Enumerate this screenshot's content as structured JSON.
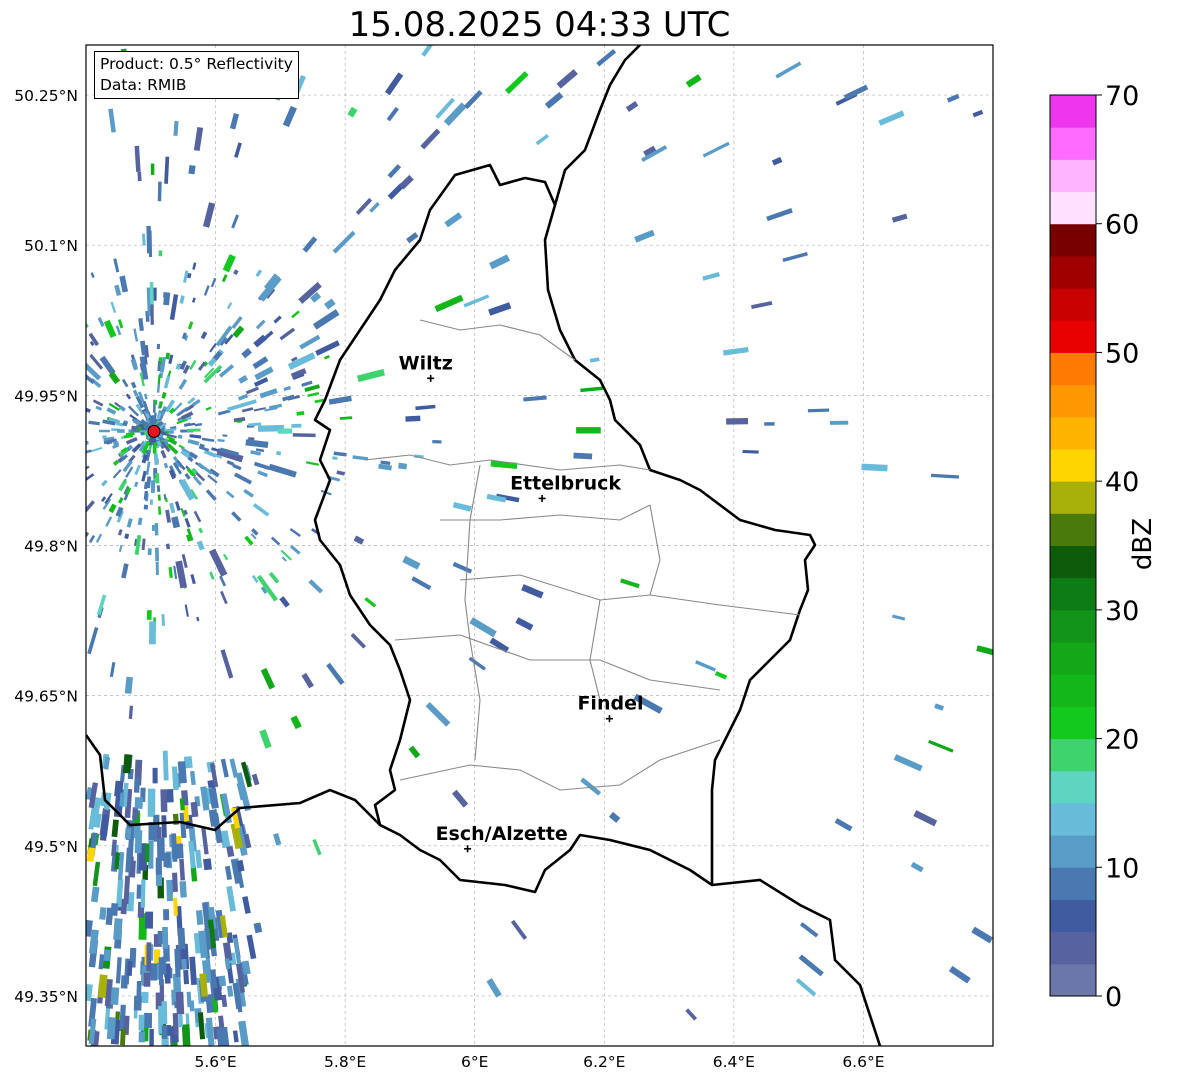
{
  "title": "15.08.2025 04:33 UTC",
  "info": {
    "product": "Product: 0.5° Reflectivity",
    "data": "Data: RMIB"
  },
  "map": {
    "lon_range": [
      5.4,
      6.8
    ],
    "lat_range": [
      49.3,
      50.3
    ],
    "lat_ticks": [
      {
        "value": 50.25,
        "label": "50.25°N"
      },
      {
        "value": 50.1,
        "label": "50.1°N"
      },
      {
        "value": 49.95,
        "label": "49.95°N"
      },
      {
        "value": 49.8,
        "label": "49.8°N"
      },
      {
        "value": 49.65,
        "label": "49.65°N"
      },
      {
        "value": 49.5,
        "label": "49.5°N"
      },
      {
        "value": 49.35,
        "label": "49.35°N"
      }
    ],
    "lon_ticks": [
      {
        "value": 5.6,
        "label": "5.6°E"
      },
      {
        "value": 5.8,
        "label": "5.8°E"
      },
      {
        "value": 6.0,
        "label": "6°E"
      },
      {
        "value": 6.2,
        "label": "6.2°E"
      },
      {
        "value": 6.4,
        "label": "6.4°E"
      },
      {
        "value": 6.6,
        "label": "6.6°E"
      }
    ],
    "grid": true,
    "radar_site": {
      "lon": 5.505,
      "lat": 49.914,
      "color": "#e8141e"
    },
    "cities": [
      {
        "name": "Wiltz",
        "lon": 5.932,
        "lat": 49.967
      },
      {
        "name": "Ettelbruck",
        "lon": 6.104,
        "lat": 49.847
      },
      {
        "name": "Findel",
        "lon": 6.208,
        "lat": 49.627
      },
      {
        "name": "Esch/Alzette",
        "lon": 5.989,
        "lat": 49.497
      }
    ]
  },
  "colorbar": {
    "label": "dBZ",
    "min": 0,
    "max": 70,
    "ticks": [
      "0",
      "10",
      "20",
      "30",
      "40",
      "50",
      "60",
      "70"
    ],
    "colors": [
      "#6a77a8",
      "#56639e",
      "#415ba0",
      "#4a78b0",
      "#5a9cc8",
      "#68bcd9",
      "#5ed5c0",
      "#3fd36e",
      "#14c91e",
      "#14b71a",
      "#12a818",
      "#12941a",
      "#0e7c14",
      "#0c5c0c",
      "#4a7a0c",
      "#a8b00a",
      "#ffd500",
      "#ffb400",
      "#ff9800",
      "#ff7a00",
      "#e80000",
      "#c80000",
      "#a00000",
      "#780000",
      "#ffe0ff",
      "#ffb4ff",
      "#ff6aff",
      "#ee36ee"
    ]
  }
}
